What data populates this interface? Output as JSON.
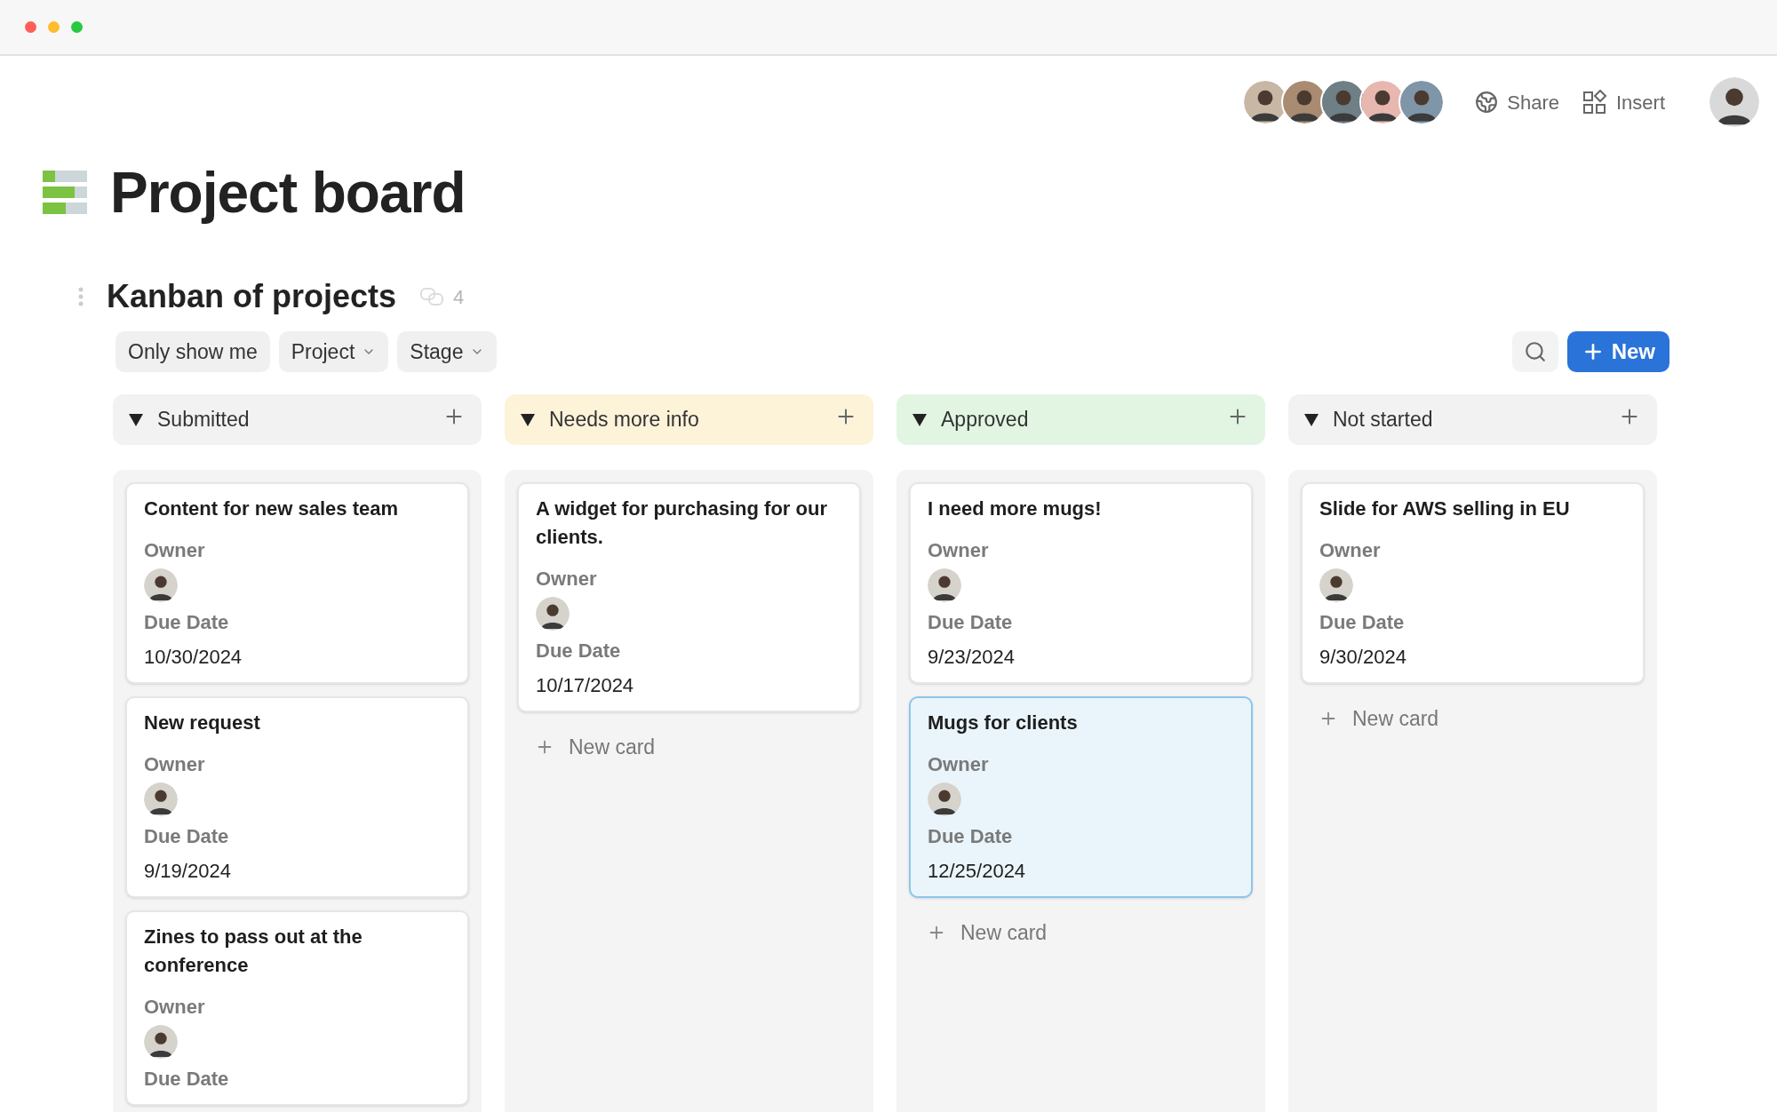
{
  "window": {
    "traffic_lights": [
      {
        "color": "#ff5f57"
      },
      {
        "color": "#febc2e"
      },
      {
        "color": "#28c840"
      }
    ]
  },
  "collaborators": [
    {
      "color": "#c9b7a6"
    },
    {
      "color": "#a98b72"
    },
    {
      "color": "#6e7f86"
    },
    {
      "color": "#e7b7b0"
    },
    {
      "color": "#7f95a8"
    }
  ],
  "toolbar": {
    "share": "Share",
    "insert": "Insert"
  },
  "page": {
    "title": "Project board"
  },
  "board": {
    "title": "Kanban of projects",
    "linked_count": "4",
    "filters": [
      {
        "label": "Only show me",
        "dropdown": false
      },
      {
        "label": "Project",
        "dropdown": true
      },
      {
        "label": "Stage",
        "dropdown": true
      }
    ],
    "new_button": "New",
    "columns": [
      {
        "title": "Submitted",
        "color": "#f2f2f2",
        "cards": [
          {
            "title": "Content for new sales team",
            "owner_label": "Owner",
            "due_label": "Due Date",
            "due": "10/30/2024",
            "selected": false
          },
          {
            "title": "New request",
            "owner_label": "Owner",
            "due_label": "Due Date",
            "due": "9/19/2024",
            "selected": false
          },
          {
            "title": "Zines to pass out at the conference",
            "owner_label": "Owner",
            "due_label": "Due Date",
            "selected": false
          }
        ]
      },
      {
        "title": "Needs more info",
        "color": "#fcf3d9",
        "new_card": "New card",
        "cards": [
          {
            "title": "A widget for purchasing for our clients.",
            "owner_label": "Owner",
            "due_label": "Due Date",
            "due": "10/17/2024",
            "selected": false
          }
        ]
      },
      {
        "title": "Approved",
        "color": "#e2f5e3",
        "new_card": "New card",
        "cards": [
          {
            "title": "I need more mugs!",
            "owner_label": "Owner",
            "due_label": "Due Date",
            "due": "9/23/2024",
            "selected": false
          },
          {
            "title": "Mugs for clients",
            "owner_label": "Owner",
            "due_label": "Due Date",
            "due": "12/25/2024",
            "selected": true
          }
        ]
      },
      {
        "title": "Not started",
        "color": "#f2f2f2",
        "new_card": "New card",
        "cards": [
          {
            "title": "Slide for AWS selling in EU",
            "owner_label": "Owner",
            "due_label": "Due Date",
            "due": "9/30/2024",
            "selected": false
          }
        ]
      }
    ]
  }
}
